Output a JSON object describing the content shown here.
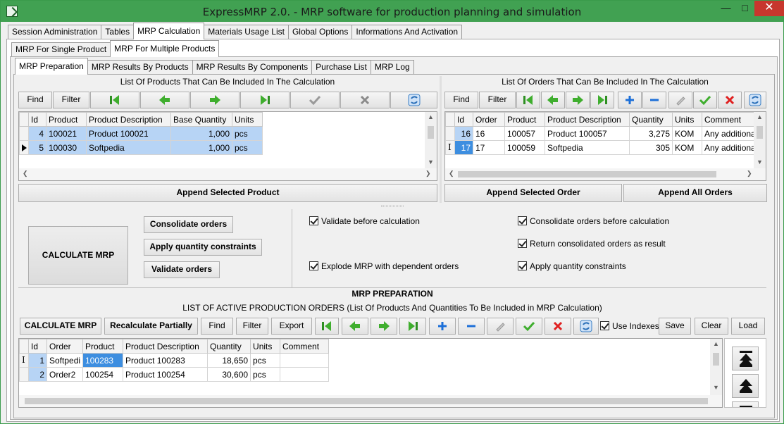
{
  "window": {
    "title": "ExpressMRP 2.0. - MRP software for production planning and simulation"
  },
  "main_tabs": [
    "Session Administration",
    "Tables",
    "MRP Calculation",
    "Materials Usage List",
    "Global Options",
    "Informations And Activation"
  ],
  "sub_tabs": [
    "MRP For Single Product",
    "MRP For Multiple Products"
  ],
  "inner_tabs": [
    "MRP Preparation",
    "MRP Results By Products",
    "MRP Results By Components",
    "Purchase List",
    "MRP Log"
  ],
  "products_panel": {
    "title": "List Of Products That Can Be Included In The Calculation",
    "find": "Find",
    "filter": "Filter",
    "columns": [
      "Id",
      "Product",
      "Product Description",
      "Base Quantity",
      "Units"
    ],
    "rows": [
      {
        "id": "4",
        "product": "100021",
        "desc": "Product 100021",
        "qty": "1,000",
        "units": "pcs"
      },
      {
        "id": "5",
        "product": "100030",
        "desc": "Softpedia",
        "qty": "1,000",
        "units": "pcs"
      }
    ],
    "append": "Append Selected Product"
  },
  "orders_panel": {
    "title": "List Of Orders That Can Be Included In The Calculation",
    "find": "Find",
    "filter": "Filter",
    "columns": [
      "Id",
      "Order",
      "Product",
      "Product Description",
      "Quantity",
      "Units",
      "Comment"
    ],
    "rows": [
      {
        "id": "16",
        "order": "16",
        "product": "100057",
        "desc": "Product 100057",
        "qty": "3,275",
        "units": "KOM",
        "comment": "Any additiona"
      },
      {
        "id": "17",
        "order": "17",
        "product": "100059",
        "desc": "Softpedia",
        "qty": "305",
        "units": "KOM",
        "comment": "Any additiona"
      }
    ],
    "append_selected": "Append Selected Order",
    "append_all": "Append All Orders"
  },
  "calc": {
    "big_button": "CALCULATE MRP",
    "consolidate": "Consolidate orders",
    "apply_constraints": "Apply quantity constraints",
    "validate": "Validate orders",
    "opt_validate": "Validate before calculation",
    "opt_explode": "Explode MRP with dependent orders",
    "opt_consolidate_before": "Consolidate orders before calculation",
    "opt_return_consolidated": "Return consolidated orders as result",
    "opt_apply_constraints": "Apply quantity constraints"
  },
  "prep": {
    "heading": "MRP PREPARATION",
    "subheading": "LIST OF ACTIVE PRODUCTION ORDERS (List Of Products And Quantities To Be Included in MRP Calculation)",
    "calc_btn": "CALCULATE MRP",
    "recalc_btn": "Recalculate Partially",
    "find": "Find",
    "filter": "Filter",
    "export": "Export",
    "use_indexes": "Use Indexes",
    "save": "Save",
    "clear": "Clear",
    "load": "Load",
    "columns": [
      "Id",
      "Order",
      "Product",
      "Product Description",
      "Quantity",
      "Units",
      "Comment"
    ],
    "rows": [
      {
        "id": "1",
        "order": "Softpedi",
        "product": "100283",
        "desc": "Product 100283",
        "qty": "18,650",
        "units": "pcs",
        "comment": ""
      },
      {
        "id": "2",
        "order": "Order2",
        "product": "100254",
        "desc": "Product 100254",
        "qty": "30,600",
        "units": "pcs",
        "comment": ""
      }
    ]
  },
  "icons": [
    "first-icon",
    "prev-icon",
    "next-icon",
    "last-icon",
    "confirm-icon",
    "cancel-icon",
    "refresh-icon",
    "add-icon",
    "remove-icon",
    "edit-icon",
    "move-top-icon",
    "move-up-icon"
  ],
  "colors": {
    "titlebar": "#41a152",
    "close": "#c7372d",
    "selection": "#b7d4f5",
    "nav_green": "#3fae2e",
    "delete_red": "#e02020",
    "add_blue": "#1c6fd8"
  }
}
